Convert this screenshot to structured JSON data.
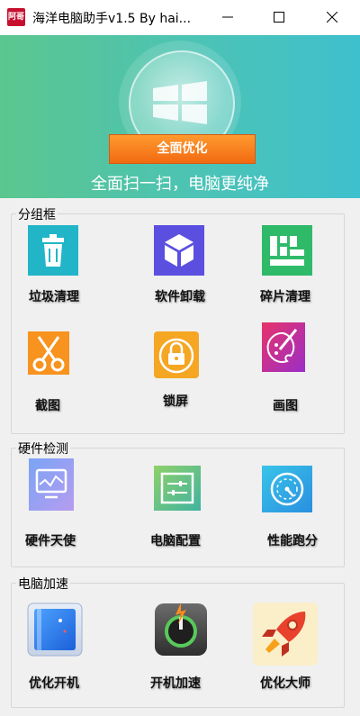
{
  "window": {
    "title": "海洋电脑助手v1.5 By hai...",
    "icon_text": "阿哥"
  },
  "hero": {
    "button_label": "全面优化",
    "slogan": "全面扫一扫，电脑更纯净"
  },
  "groups": {
    "group1": {
      "title": "分组框",
      "items": [
        "垃圾清理",
        "软件卸载",
        "碎片清理",
        "截图",
        "锁屏",
        "画图"
      ]
    },
    "group2": {
      "title": "硬件检测",
      "items": [
        "硬件天使",
        "电脑配置",
        "性能跑分"
      ]
    },
    "group3": {
      "title": "电脑加速",
      "items": [
        "优化开机",
        "开机加速",
        "优化大师"
      ]
    }
  },
  "icons": {
    "trash": "trash-icon",
    "cube": "cube-icon",
    "defrag": "defrag-icon",
    "scissors": "scissors-icon",
    "lock": "lock-icon",
    "paint": "paint-palette-icon",
    "monitor": "monitor-wave-icon",
    "config": "config-sliders-icon",
    "gauge": "speed-gauge-icon",
    "boot": "boot-optimize-icon",
    "power": "power-icon",
    "rocket": "rocket-icon"
  },
  "colors": {
    "hero_start": "#5bc68e",
    "hero_end": "#3fc0cd",
    "button_orange": "#f26a12"
  }
}
